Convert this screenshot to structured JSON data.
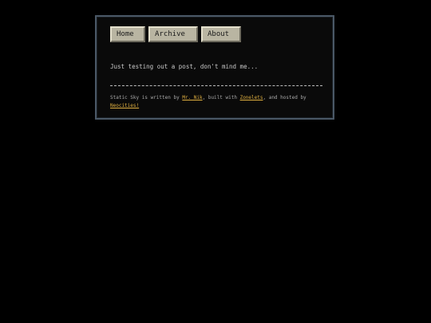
{
  "nav": {
    "home": "Home",
    "archive": "Archive",
    "about": "About"
  },
  "post": {
    "text": "Just testing out a post, don't mind me..."
  },
  "footer": {
    "prefix": "Static Sky is written by ",
    "author_link": "Mr. Nik",
    "middle": ", built with ",
    "built_link": "Zonelets",
    "suffix": ", and hosted by ",
    "host_link": "Neocities!"
  },
  "colors": {
    "background": "#000000",
    "frame_border": "#4a5866",
    "button_face": "#b9b5a2",
    "link": "#e0b040",
    "text": "#c9c9c9"
  }
}
